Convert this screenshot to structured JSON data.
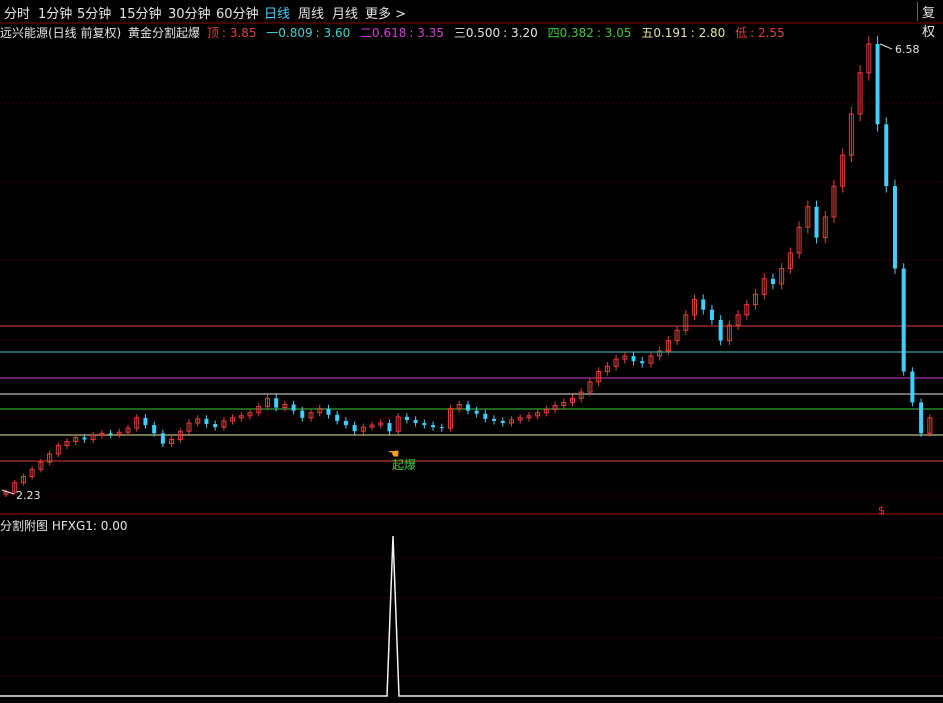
{
  "toolbar": {
    "items": [
      "分时",
      "1分钟",
      "5分钟",
      "15分钟",
      "30分钟",
      "60分钟",
      "日线",
      "周线",
      "月线",
      "更多"
    ],
    "more_arrow": ">",
    "active": "日线",
    "right_button": "复权"
  },
  "main": {
    "stock_name": "远兴能源(日线 前复权)",
    "indicator_name": "黄金分割起爆",
    "levels": [
      {
        "label": "顶",
        "value": "3.85",
        "color": "#e23d3d"
      },
      {
        "label": "一0.809",
        "value": "3.60",
        "color": "#3fd0d0"
      },
      {
        "label": "二0.618",
        "value": "3.35",
        "color": "#d23fd2"
      },
      {
        "label": "三0.500",
        "value": "3.20",
        "color": "#e6e6e6"
      },
      {
        "label": "四0.382",
        "value": "3.05",
        "color": "#3ccb3c"
      },
      {
        "label": "五0.191",
        "value": "2.80",
        "color": "#e6e6a0"
      },
      {
        "label": "低",
        "value": "2.55",
        "color": "#e23d3d"
      }
    ],
    "high_label": "6.58",
    "low_label": "2.23",
    "signal_text": "起爆",
    "dollar_mark": "$"
  },
  "sub": {
    "title": "分割附图",
    "indicator": "HFXG1: 0.00"
  },
  "colors": {
    "up": "#e23d3d",
    "down": "#3fd0ff",
    "signal": "#3ccb3c",
    "grid": "#7a0000"
  },
  "chart_data": {
    "type": "candlestick",
    "high": 6.58,
    "low": 2.23,
    "closes": [
      2.23,
      2.32,
      2.38,
      2.45,
      2.52,
      2.6,
      2.68,
      2.72,
      2.76,
      2.74,
      2.78,
      2.8,
      2.79,
      2.81,
      2.85,
      2.95,
      2.88,
      2.8,
      2.7,
      2.74,
      2.82,
      2.9,
      2.94,
      2.89,
      2.86,
      2.92,
      2.95,
      2.97,
      3.0,
      3.06,
      3.14,
      3.05,
      3.08,
      3.02,
      2.95,
      3.0,
      3.04,
      2.98,
      2.92,
      2.88,
      2.82,
      2.86,
      2.88,
      2.9,
      2.82,
      2.96,
      2.93,
      2.9,
      2.88,
      2.86,
      2.85,
      3.04,
      3.08,
      3.02,
      2.99,
      2.94,
      2.92,
      2.9,
      2.93,
      2.95,
      2.97,
      3.0,
      3.03,
      3.07,
      3.1,
      3.14,
      3.2,
      3.3,
      3.4,
      3.45,
      3.52,
      3.55,
      3.5,
      3.48,
      3.55,
      3.6,
      3.7,
      3.8,
      3.95,
      4.1,
      4.0,
      3.9,
      3.7,
      3.85,
      3.95,
      4.05,
      4.15,
      4.3,
      4.25,
      4.4,
      4.55,
      4.8,
      5.0,
      4.7,
      4.9,
      5.2,
      5.5,
      5.9,
      6.3,
      6.58,
      5.8,
      5.2,
      4.4,
      3.4,
      3.1,
      2.8,
      2.95
    ]
  }
}
